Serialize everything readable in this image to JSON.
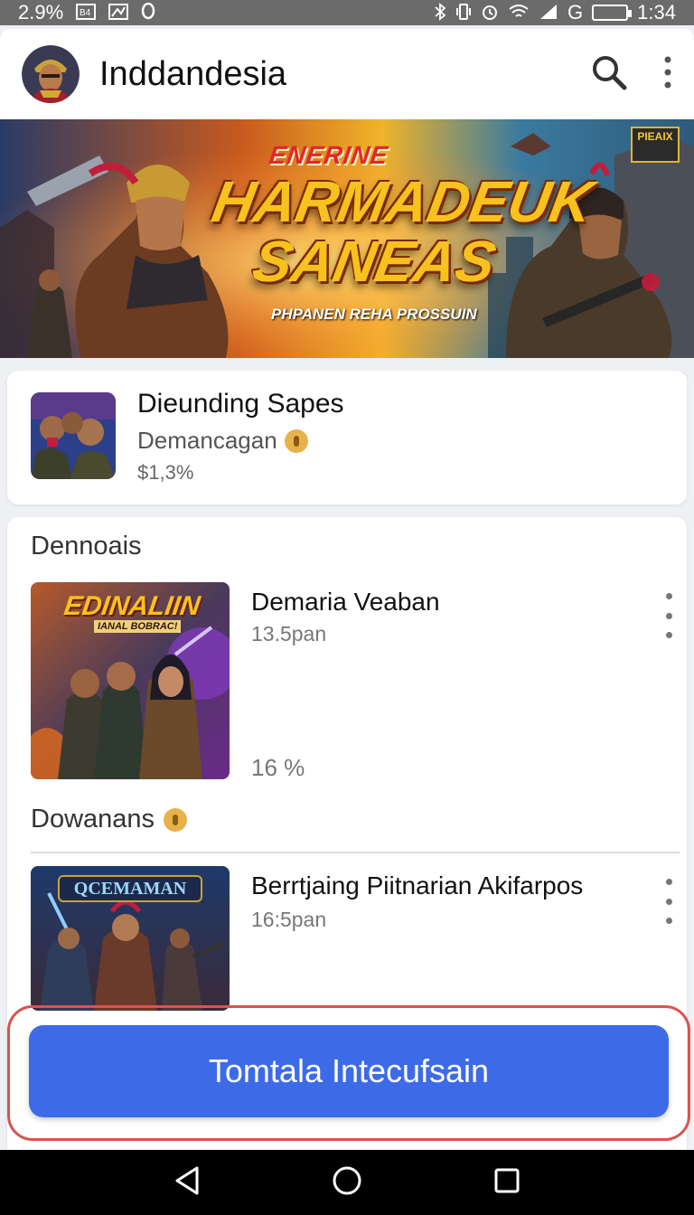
{
  "status_bar": {
    "battery_percent_text": "2.9%",
    "left_icons": [
      "b4-icon",
      "image-icon",
      "location-icon"
    ],
    "right_icons": [
      "bluetooth-icon",
      "vibrate-icon",
      "alarm-icon",
      "wifi-icon",
      "signal-icon"
    ],
    "network_label": "G",
    "time": "1:34"
  },
  "app_bar": {
    "title": "Inddandesia",
    "icons": [
      "search-icon",
      "more-vert-icon"
    ]
  },
  "banner": {
    "top_label": "ENERINE",
    "title_line1": "HARMADEUK",
    "title_line2": "SANEAS",
    "subtitle": "PHPANEN REHA PROSSUIN",
    "badge_text": "PIEAIX"
  },
  "featured": {
    "title": "Dieunding Sapes",
    "subtitle": "Demancagan",
    "meta": "$1,3%"
  },
  "sections": [
    {
      "title": "Dennoais",
      "items": [
        {
          "title": "Demaria Veaban",
          "meta": "13.5pan",
          "rating": "16 %",
          "thumb_label": "EDINALIIN",
          "thumb_sublabel": "IANAL BOBRAC!"
        }
      ]
    },
    {
      "title": "Dowanans",
      "items": [
        {
          "title": "Berrtjaing Piitnarian Akifarpos",
          "meta": "16:5pan",
          "thumb_label": "QCEMAMAN"
        }
      ]
    }
  ],
  "cta": {
    "label": "Tomtala Intecufsain",
    "color": "#3d6be8",
    "outline_color": "#d9534f"
  },
  "nav_bar": {
    "icons": [
      "back-icon",
      "home-icon",
      "recents-icon"
    ]
  }
}
